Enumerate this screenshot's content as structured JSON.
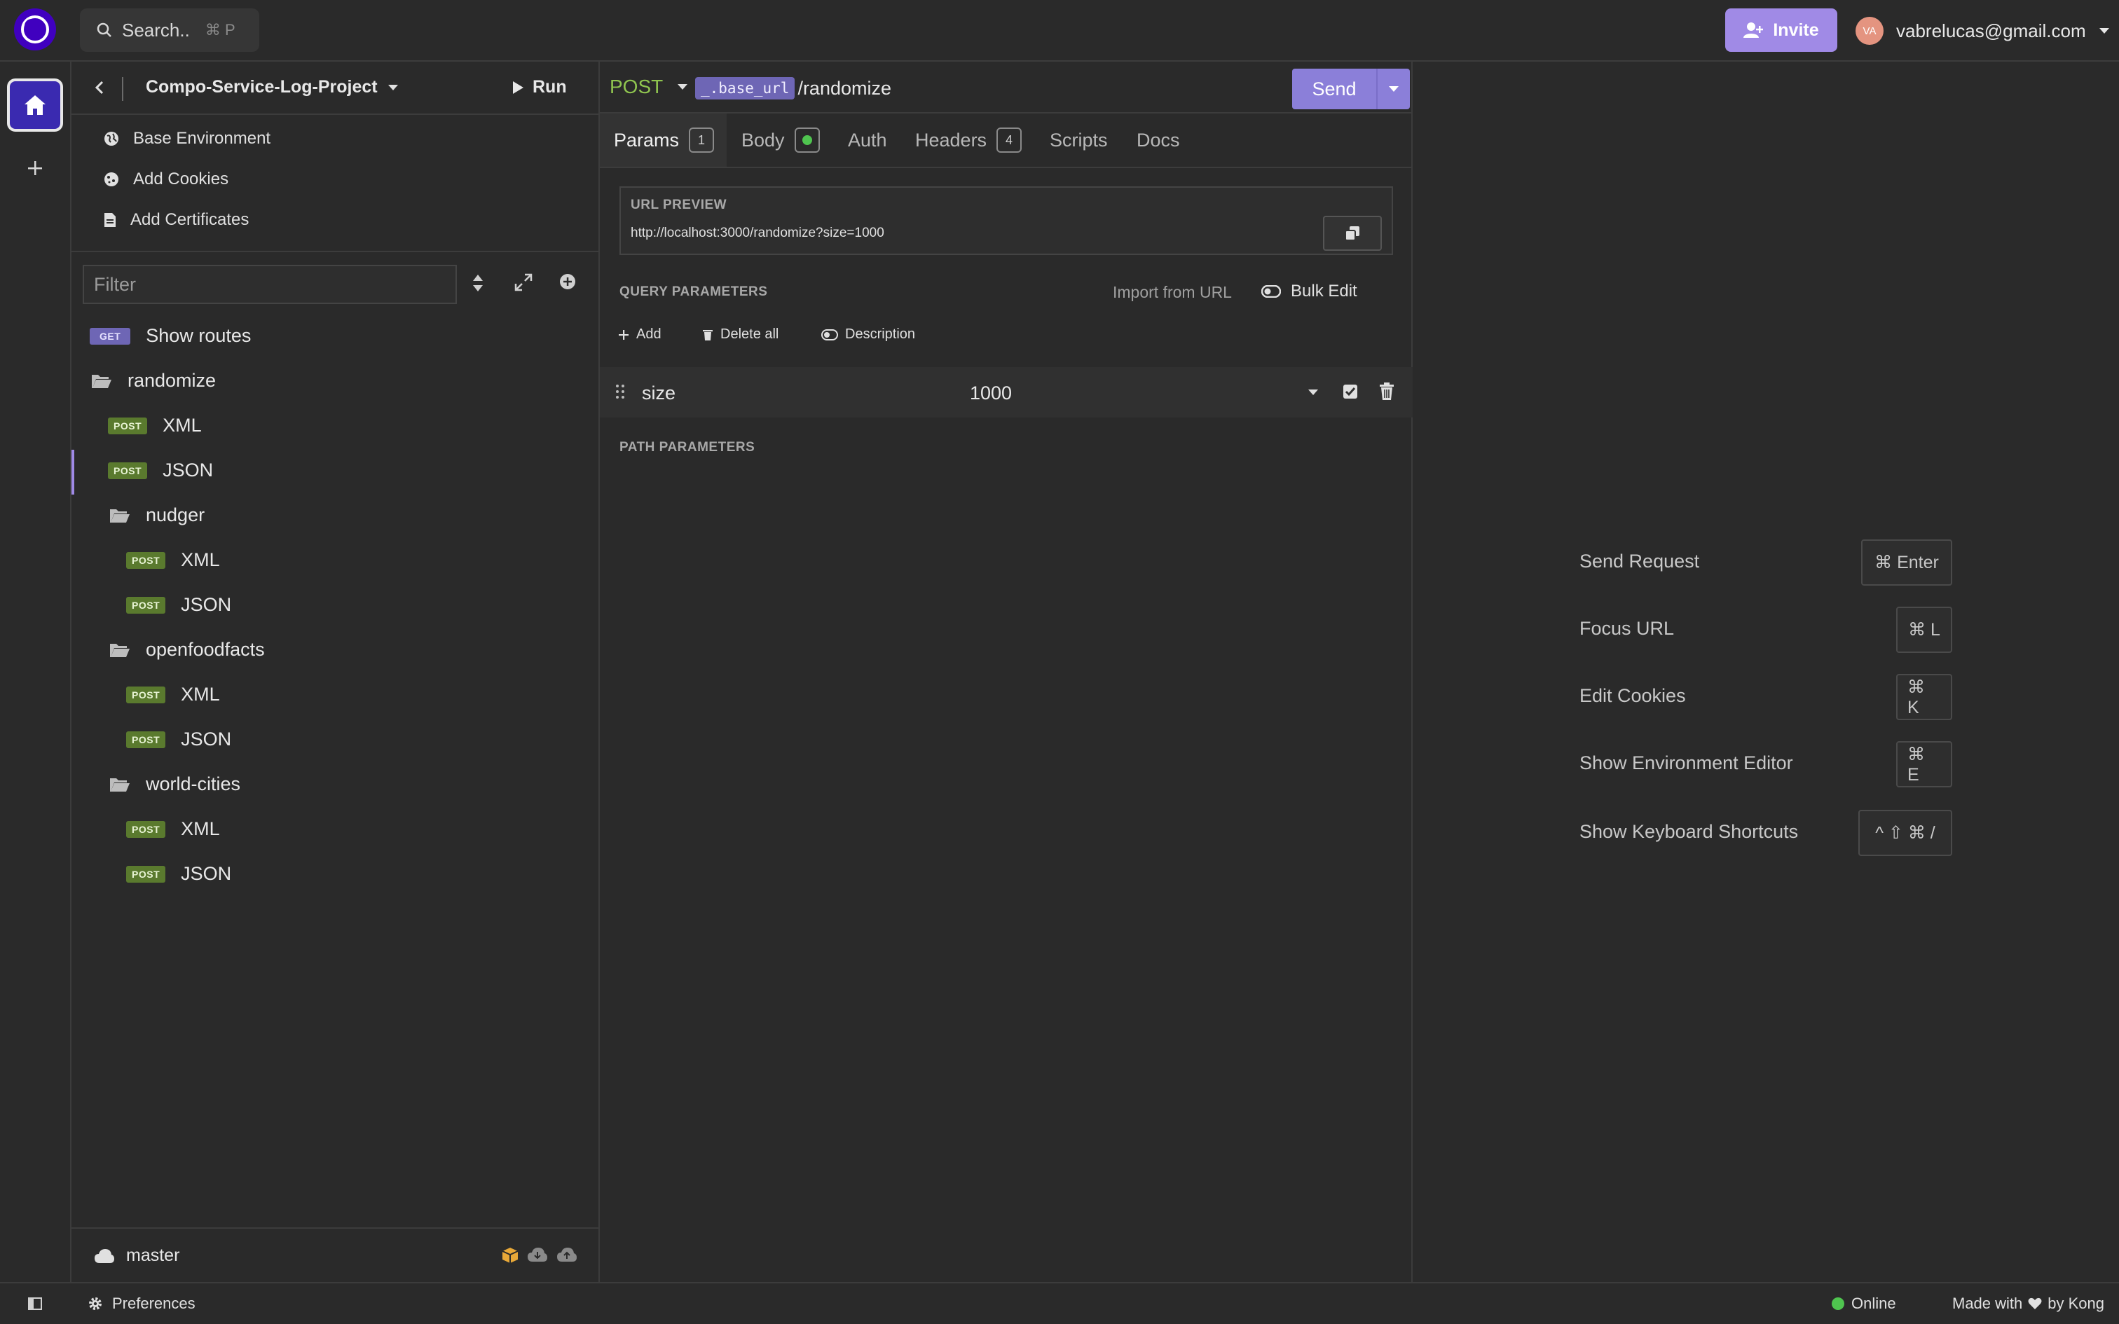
{
  "topbar": {
    "search_label": "Search..",
    "search_shortcut": "⌘ P",
    "invite_label": "Invite",
    "avatar_initials": "VA",
    "user_email": "vabrelucas@gmail.com"
  },
  "sidebar": {
    "project_name": "Compo-Service-Log-Project",
    "run_label": "Run",
    "links": [
      {
        "label": "Base Environment",
        "icon": "globe-icon"
      },
      {
        "label": "Add Cookies",
        "icon": "cookie-icon"
      },
      {
        "label": "Add Certificates",
        "icon": "certificate-icon"
      }
    ],
    "filter_placeholder": "Filter",
    "tree": {
      "show_routes": {
        "method": "GET",
        "label": "Show routes"
      },
      "randomize": {
        "label": "randomize"
      },
      "randomize_xml": {
        "method": "POST",
        "label": "XML"
      },
      "randomize_json": {
        "method": "POST",
        "label": "JSON"
      },
      "nudger": {
        "label": "nudger"
      },
      "nudger_xml": {
        "method": "POST",
        "label": "XML"
      },
      "nudger_json": {
        "method": "POST",
        "label": "JSON"
      },
      "openfoodfacts": {
        "label": "openfoodfacts"
      },
      "openfoodfacts_xml": {
        "method": "POST",
        "label": "XML"
      },
      "openfoodfacts_json": {
        "method": "POST",
        "label": "JSON"
      },
      "world_cities": {
        "label": "world-cities"
      },
      "world_cities_xml": {
        "method": "POST",
        "label": "XML"
      },
      "world_cities_json": {
        "method": "POST",
        "label": "JSON"
      }
    },
    "branch": "master"
  },
  "request": {
    "method": "POST",
    "url_var": "_.base_url",
    "url_path": "/randomize",
    "send_label": "Send",
    "tabs": {
      "params": {
        "label": "Params",
        "count": "1"
      },
      "body": {
        "label": "Body"
      },
      "auth": {
        "label": "Auth"
      },
      "headers": {
        "label": "Headers",
        "count": "4"
      },
      "scripts": {
        "label": "Scripts"
      },
      "docs": {
        "label": "Docs"
      }
    },
    "url_preview_title": "URL PREVIEW",
    "url_preview_value": "http://localhost:3000/randomize?size=1000",
    "query_params_title": "QUERY PARAMETERS",
    "import_from_url": "Import from URL",
    "bulk_edit": "Bulk Edit",
    "actions": {
      "add": "Add",
      "delete_all": "Delete all",
      "description": "Description"
    },
    "params": [
      {
        "key": "size",
        "value": "1000",
        "enabled": true
      }
    ],
    "path_params_title": "PATH PARAMETERS"
  },
  "shortcuts": [
    {
      "label": "Send Request",
      "keys": "⌘ Enter"
    },
    {
      "label": "Focus URL",
      "keys": "⌘ L"
    },
    {
      "label": "Edit Cookies",
      "keys": "⌘ K"
    },
    {
      "label": "Show Environment Editor",
      "keys": "⌘ E"
    },
    {
      "label": "Show Keyboard Shortcuts",
      "keys": "^ ⇧ ⌘ /"
    }
  ],
  "statusbar": {
    "preferences": "Preferences",
    "online": "Online",
    "made_with": "Made with",
    "by_kong": "by Kong"
  },
  "colors": {
    "accent": "#8b7fd9",
    "post_badge": "#5a7a2e",
    "get_badge": "#6e66b5",
    "method_post": "#8fc44f",
    "online_dot": "#4fc44f"
  }
}
